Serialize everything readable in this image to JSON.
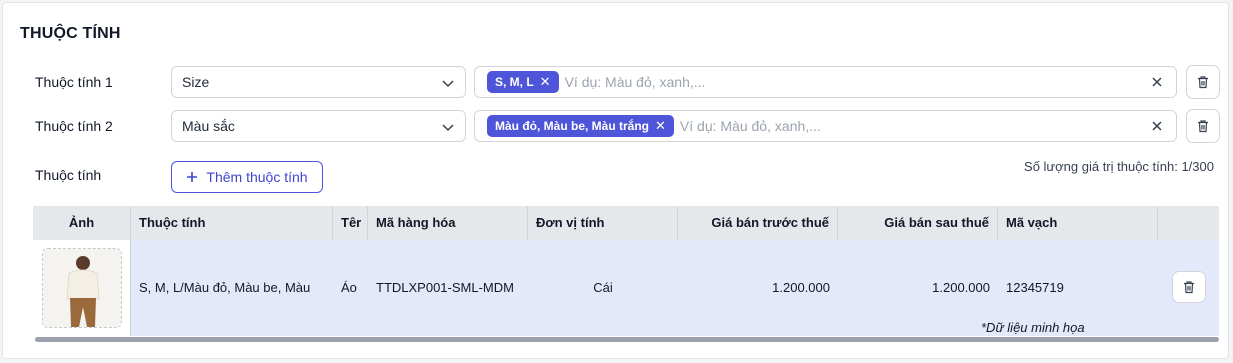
{
  "section": {
    "title": "THUỘC TÍNH"
  },
  "attr1": {
    "label": "Thuộc tính 1",
    "select_value": "Size",
    "tags": [
      "S, M, L"
    ],
    "placeholder": "Ví dụ: Màu đỏ, xanh,..."
  },
  "attr2": {
    "label": "Thuộc tính 2",
    "select_value": "Màu sắc",
    "tags": [
      "Màu đỏ, Màu be, Màu trắng"
    ],
    "placeholder": "Ví dụ: Màu đỏ, xanh,..."
  },
  "add": {
    "label": "Thuộc tính",
    "button_label": "Thêm thuộc tính"
  },
  "count_text": "Số lượng giá trị thuộc tính: 1/300",
  "table": {
    "headers": [
      "Ảnh",
      "Thuộc tính",
      "Têr",
      "Mã hàng hóa",
      "Đơn vị tính",
      "Giá bán trước thuế",
      "Giá bán sau thuế",
      "Mã vạch"
    ],
    "rows": [
      {
        "thuoc_tinh": "S, M, L/Màu đỏ, Màu be, Màu",
        "ten": "Áo",
        "ma_hang_hoa": "TTDLXP001-SML-MDM",
        "don_vi_tinh": "Cái",
        "gia_truoc_thue": "1.200.000",
        "gia_sau_thue": "1.200.000",
        "ma_vach": "12345719"
      }
    ]
  },
  "note": "*Dữ liệu minh họa",
  "colors": {
    "accent": "#4f55d9",
    "row_bg": "#e3e9fb",
    "header_bg": "#e5e7eb"
  }
}
